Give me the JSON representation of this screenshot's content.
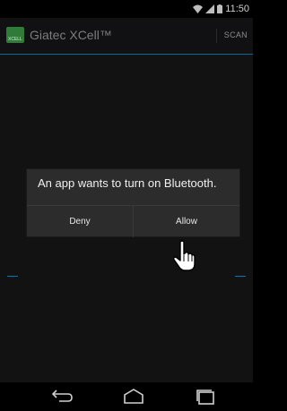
{
  "status_bar": {
    "time": "11:50",
    "icons": [
      "wifi-icon",
      "signal-icon",
      "battery-icon"
    ]
  },
  "action_bar": {
    "logo_text": "XCELL",
    "title": "Giatec XCell™",
    "scan_label": "SCAN"
  },
  "dialog": {
    "message": "An app wants to turn on Bluetooth.",
    "deny_label": "Deny",
    "allow_label": "Allow"
  },
  "nav_bar": {
    "icons": [
      "back-icon",
      "home-icon",
      "recent-apps-icon"
    ]
  },
  "colors": {
    "accent": "#2d5f78",
    "logo_green": "#2f7b38",
    "dialog_bg": "#2c2c2c"
  }
}
